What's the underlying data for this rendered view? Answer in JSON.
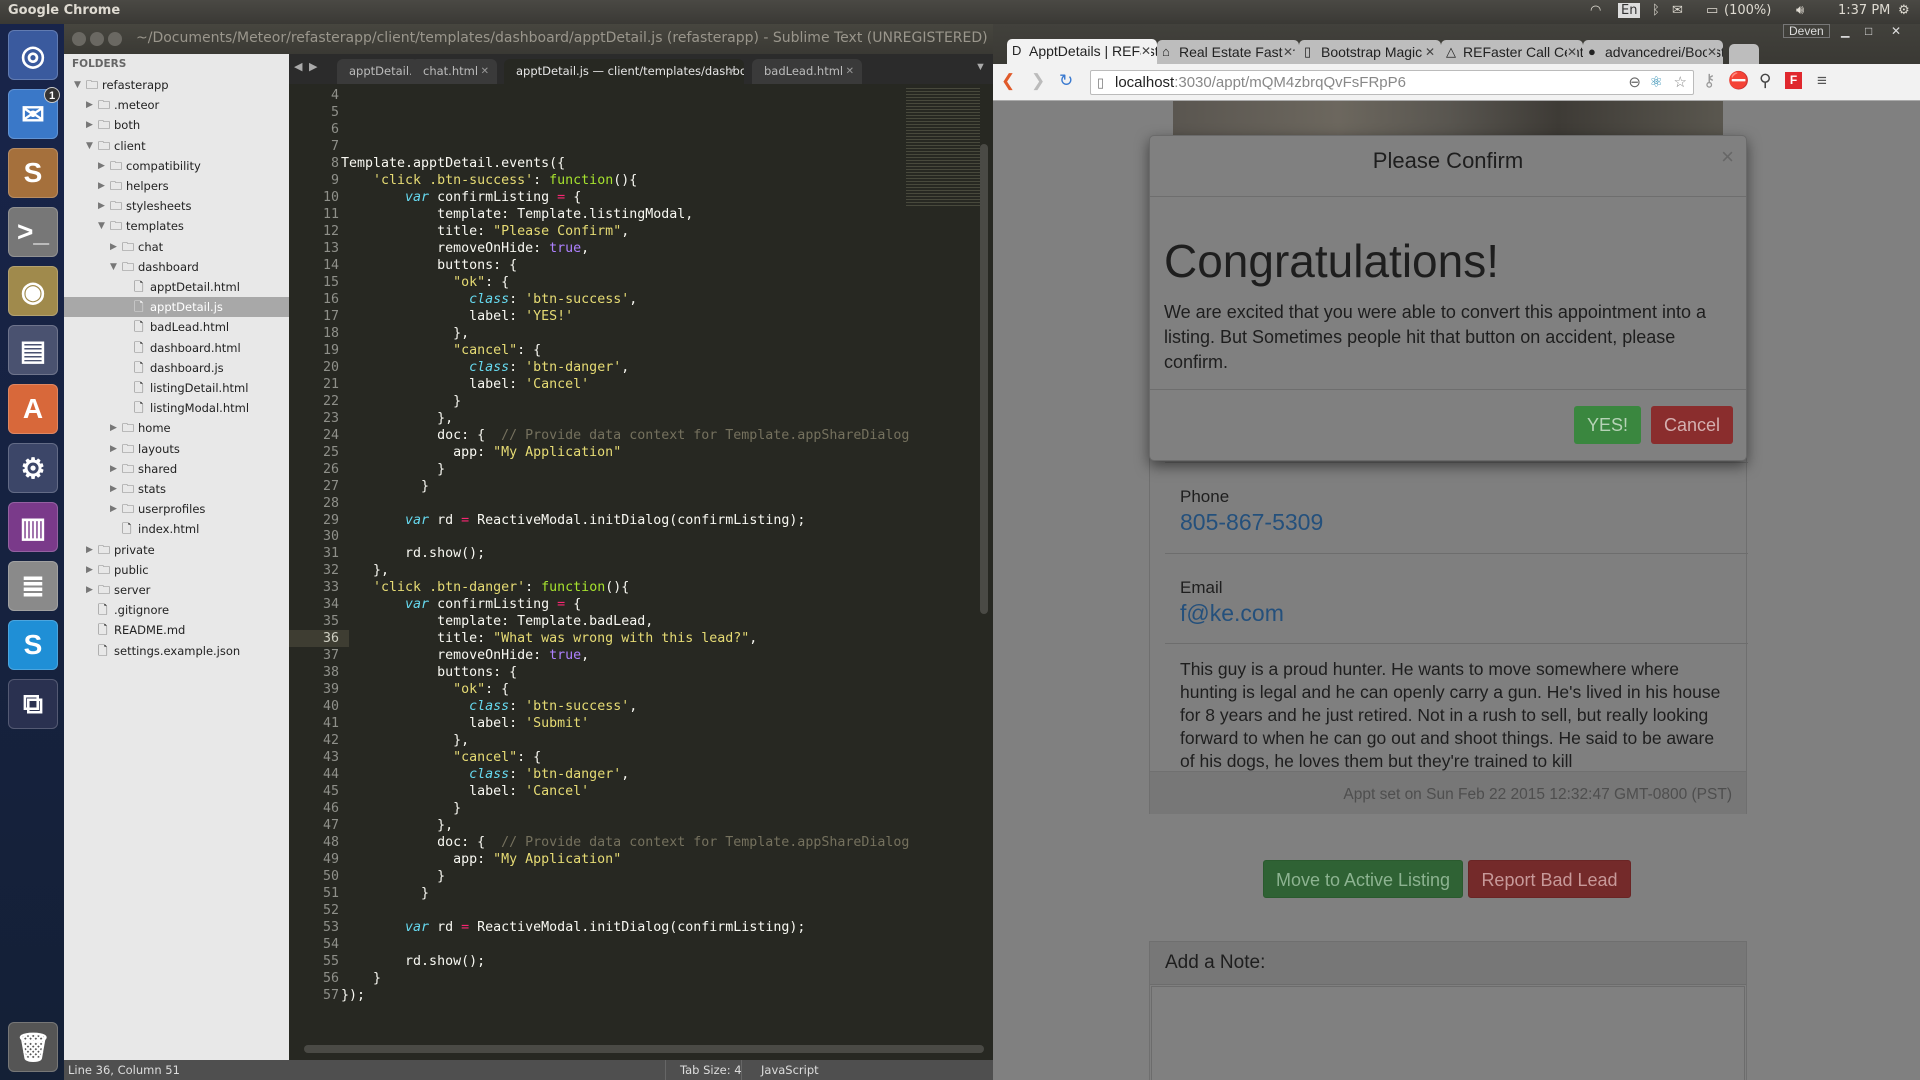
{
  "top_panel": {
    "app_name": "Google Chrome",
    "keyboard": "En",
    "battery": "(100%)",
    "clock": "1:37 PM"
  },
  "launcher": {
    "items": [
      {
        "name": "ubuntu-dash-icon",
        "glyph": "◎",
        "color": "#3a5a9e"
      },
      {
        "name": "thunderbird-icon",
        "glyph": "✉",
        "color": "#3a78c8",
        "badge": "1"
      },
      {
        "name": "sublime-text-icon",
        "glyph": "S",
        "color": "#a5703c"
      },
      {
        "name": "terminal-icon",
        "glyph": ">_",
        "color": "#777"
      },
      {
        "name": "chrome-icon",
        "glyph": "◉",
        "color": "#a08a4c"
      },
      {
        "name": "file-cabinet-icon",
        "glyph": "▤",
        "color": "#4a5270"
      },
      {
        "name": "software-center-icon",
        "glyph": "A",
        "color": "#d8683a"
      },
      {
        "name": "system-settings-icon",
        "glyph": "⚙",
        "color": "#3c4668"
      },
      {
        "name": "purple-app-icon",
        "glyph": "▥",
        "color": "#7a3a8a"
      },
      {
        "name": "database-icon",
        "glyph": "≣",
        "color": "#8a8a8a"
      },
      {
        "name": "skype-icon",
        "glyph": "S",
        "color": "#1f8fd6"
      },
      {
        "name": "workspace-switcher-icon",
        "glyph": "⧉",
        "color": "#2a3150"
      }
    ],
    "trash": {
      "name": "trash-icon",
      "glyph": "🗑"
    }
  },
  "sublime": {
    "title": "~/Documents/Meteor/refasterapp/client/templates/dashboard/apptDetail.js (refasterapp) - Sublime Text (UNREGISTERED)",
    "sidebar_header": "FOLDERS",
    "tree": [
      {
        "label": "refasterapp",
        "depth": 0,
        "type": "folder-open"
      },
      {
        "label": ".meteor",
        "depth": 1,
        "type": "folder"
      },
      {
        "label": "both",
        "depth": 1,
        "type": "folder"
      },
      {
        "label": "client",
        "depth": 1,
        "type": "folder-open"
      },
      {
        "label": "compatibility",
        "depth": 2,
        "type": "folder"
      },
      {
        "label": "helpers",
        "depth": 2,
        "type": "folder"
      },
      {
        "label": "stylesheets",
        "depth": 2,
        "type": "folder"
      },
      {
        "label": "templates",
        "depth": 2,
        "type": "folder-open"
      },
      {
        "label": "chat",
        "depth": 3,
        "type": "folder"
      },
      {
        "label": "dashboard",
        "depth": 3,
        "type": "folder-open"
      },
      {
        "label": "apptDetail.html",
        "depth": 4,
        "type": "file"
      },
      {
        "label": "apptDetail.js",
        "depth": 4,
        "type": "file",
        "selected": true
      },
      {
        "label": "badLead.html",
        "depth": 4,
        "type": "file"
      },
      {
        "label": "dashboard.html",
        "depth": 4,
        "type": "file"
      },
      {
        "label": "dashboard.js",
        "depth": 4,
        "type": "file"
      },
      {
        "label": "listingDetail.html",
        "depth": 4,
        "type": "file"
      },
      {
        "label": "listingModal.html",
        "depth": 4,
        "type": "file"
      },
      {
        "label": "home",
        "depth": 3,
        "type": "folder"
      },
      {
        "label": "layouts",
        "depth": 3,
        "type": "folder"
      },
      {
        "label": "shared",
        "depth": 3,
        "type": "folder"
      },
      {
        "label": "stats",
        "depth": 3,
        "type": "folder"
      },
      {
        "label": "userprofiles",
        "depth": 3,
        "type": "folder"
      },
      {
        "label": "index.html",
        "depth": 3,
        "type": "file"
      },
      {
        "label": "private",
        "depth": 1,
        "type": "folder"
      },
      {
        "label": "public",
        "depth": 1,
        "type": "folder"
      },
      {
        "label": "server",
        "depth": 1,
        "type": "folder"
      },
      {
        "label": ".gitignore",
        "depth": 1,
        "type": "file"
      },
      {
        "label": "README.md",
        "depth": 1,
        "type": "file"
      },
      {
        "label": "settings.example.json",
        "depth": 1,
        "type": "file"
      }
    ],
    "tabs": [
      {
        "label": "apptDetail.js"
      },
      {
        "label": "chat.html"
      },
      {
        "label": "apptDetail.js — client/templates/dashboard",
        "active": true
      },
      {
        "label": "badLead.html"
      }
    ],
    "first_line": 4,
    "current_line": 36,
    "code": [
      [],
      [],
      [],
      [],
      [
        [
          "p",
          "Template.apptDetail.events({"
        ]
      ],
      [
        [
          "p",
          "    "
        ],
        [
          "s",
          "'click .btn-success'"
        ],
        [
          "p",
          ": "
        ],
        [
          "f",
          "function"
        ],
        [
          "p",
          "(){"
        ]
      ],
      [
        [
          "p",
          "        "
        ],
        [
          "k",
          "var"
        ],
        [
          "p",
          " confirmListing "
        ],
        [
          "o",
          "="
        ],
        [
          "p",
          " {"
        ]
      ],
      [
        [
          "p",
          "            template: Template.listingModal,"
        ]
      ],
      [
        [
          "p",
          "            title: "
        ],
        [
          "s",
          "\"Please Confirm\""
        ],
        [
          "p",
          ","
        ]
      ],
      [
        [
          "p",
          "            removeOnHide: "
        ],
        [
          "b",
          "true"
        ],
        [
          "p",
          ","
        ]
      ],
      [
        [
          "p",
          "            buttons: {"
        ]
      ],
      [
        [
          "p",
          "              "
        ],
        [
          "s",
          "\"ok\""
        ],
        [
          "p",
          ": {"
        ]
      ],
      [
        [
          "p",
          "                "
        ],
        [
          "a",
          "class"
        ],
        [
          "p",
          ": "
        ],
        [
          "s",
          "'btn-success'"
        ],
        [
          "p",
          ","
        ]
      ],
      [
        [
          "p",
          "                label: "
        ],
        [
          "s",
          "'YES!'"
        ]
      ],
      [
        [
          "p",
          "              },"
        ]
      ],
      [
        [
          "p",
          "              "
        ],
        [
          "s",
          "\"cancel\""
        ],
        [
          "p",
          ": {"
        ]
      ],
      [
        [
          "p",
          "                "
        ],
        [
          "a",
          "class"
        ],
        [
          "p",
          ": "
        ],
        [
          "s",
          "'btn-danger'"
        ],
        [
          "p",
          ","
        ]
      ],
      [
        [
          "p",
          "                label: "
        ],
        [
          "s",
          "'Cancel'"
        ]
      ],
      [
        [
          "p",
          "              }"
        ]
      ],
      [
        [
          "p",
          "            },"
        ]
      ],
      [
        [
          "p",
          "            doc: {  "
        ],
        [
          "c",
          "// Provide data context for Template.appShareDialog"
        ]
      ],
      [
        [
          "p",
          "              app: "
        ],
        [
          "s",
          "\"My Application\""
        ]
      ],
      [
        [
          "p",
          "            }"
        ]
      ],
      [
        [
          "p",
          "          }"
        ]
      ],
      [],
      [
        [
          "p",
          "        "
        ],
        [
          "k",
          "var"
        ],
        [
          "p",
          " rd "
        ],
        [
          "o",
          "="
        ],
        [
          "p",
          " ReactiveModal.initDialog(confirmListing);"
        ]
      ],
      [],
      [
        [
          "p",
          "        rd.show();"
        ]
      ],
      [
        [
          "p",
          "    },"
        ]
      ],
      [
        [
          "p",
          "    "
        ],
        [
          "s",
          "'click .btn-danger'"
        ],
        [
          "p",
          ": "
        ],
        [
          "f",
          "function"
        ],
        [
          "p",
          "(){"
        ]
      ],
      [
        [
          "p",
          "        "
        ],
        [
          "k",
          "var"
        ],
        [
          "p",
          " confirmListing "
        ],
        [
          "o",
          "="
        ],
        [
          "p",
          " {"
        ]
      ],
      [
        [
          "p",
          "            template: Template.badLead,"
        ]
      ],
      [
        [
          "p",
          "            title: "
        ],
        [
          "s",
          "\"What was wrong with this lead?\""
        ],
        [
          "p",
          ","
        ]
      ],
      [
        [
          "p",
          "            removeOnHide: "
        ],
        [
          "b",
          "true"
        ],
        [
          "p",
          ","
        ]
      ],
      [
        [
          "p",
          "            buttons: {"
        ]
      ],
      [
        [
          "p",
          "              "
        ],
        [
          "s",
          "\"ok\""
        ],
        [
          "p",
          ": {"
        ]
      ],
      [
        [
          "p",
          "                "
        ],
        [
          "a",
          "class"
        ],
        [
          "p",
          ": "
        ],
        [
          "s",
          "'btn-success'"
        ],
        [
          "p",
          ","
        ]
      ],
      [
        [
          "p",
          "                label: "
        ],
        [
          "s",
          "'Submit'"
        ]
      ],
      [
        [
          "p",
          "              },"
        ]
      ],
      [
        [
          "p",
          "              "
        ],
        [
          "s",
          "\"cancel\""
        ],
        [
          "p",
          ": {"
        ]
      ],
      [
        [
          "p",
          "                "
        ],
        [
          "a",
          "class"
        ],
        [
          "p",
          ": "
        ],
        [
          "s",
          "'btn-danger'"
        ],
        [
          "p",
          ","
        ]
      ],
      [
        [
          "p",
          "                label: "
        ],
        [
          "s",
          "'Cancel'"
        ]
      ],
      [
        [
          "p",
          "              }"
        ]
      ],
      [
        [
          "p",
          "            },"
        ]
      ],
      [
        [
          "p",
          "            doc: {  "
        ],
        [
          "c",
          "// Provide data context for Template.appShareDialog"
        ]
      ],
      [
        [
          "p",
          "              app: "
        ],
        [
          "s",
          "\"My Application\""
        ]
      ],
      [
        [
          "p",
          "            }"
        ]
      ],
      [
        [
          "p",
          "          }"
        ]
      ],
      [],
      [
        [
          "p",
          "        "
        ],
        [
          "k",
          "var"
        ],
        [
          "p",
          " rd "
        ],
        [
          "o",
          "="
        ],
        [
          "p",
          " ReactiveModal.initDialog(confirmListing);"
        ]
      ],
      [],
      [
        [
          "p",
          "        rd.show();"
        ]
      ],
      [
        [
          "p",
          "    }"
        ]
      ],
      [
        [
          "p",
          "});"
        ]
      ]
    ],
    "status": {
      "position": "Line 36, Column 51",
      "tab_size": "Tab Size: 4",
      "syntax": "JavaScript"
    }
  },
  "chrome": {
    "profile": "Deven",
    "tabs": [
      {
        "label": "ApptDetails | REFaster",
        "icon": "D",
        "active": true
      },
      {
        "label": "Real Estate Faster",
        "icon": "⌂"
      },
      {
        "label": "Bootstrap Magic",
        "icon": "▯"
      },
      {
        "label": "REFaster Call Center",
        "icon": "△"
      },
      {
        "label": "advancedrei/Bootstrap",
        "icon": "●"
      }
    ],
    "url_host": "localhost",
    "url_rest": ":3030/appt/mQM4zbrqQvFsFRpP6",
    "page": {
      "phone_label": "Phone",
      "phone": "805-867-5309",
      "email_label": "Email",
      "email": "f@ke.com",
      "description": "This guy is a proud hunter. He wants to move somewhere where hunting is legal and he can openly carry a gun. He's lived in his house for 8 years and he just retired. Not in a rush to sell, but really looking forward to when he can go out and shoot things. He said to be aware of his dogs, he loves them but they're trained to kill",
      "appt_footer": "Appt set on Sun Feb 22 2015 12:32:47 GMT-0800 (PST)",
      "move_button": "Move to Active Listing",
      "bad_lead_button": "Report Bad Lead",
      "note_heading": "Add a Note:",
      "note_value": ""
    },
    "modal": {
      "title": "Please Confirm",
      "close": "×",
      "heading": "Congratulations!",
      "body": "We are excited that you were able to convert this appointment into a listing. But Sometimes people hit that button on accident, please confirm.",
      "yes_button": "YES!",
      "cancel_button": "Cancel"
    }
  }
}
